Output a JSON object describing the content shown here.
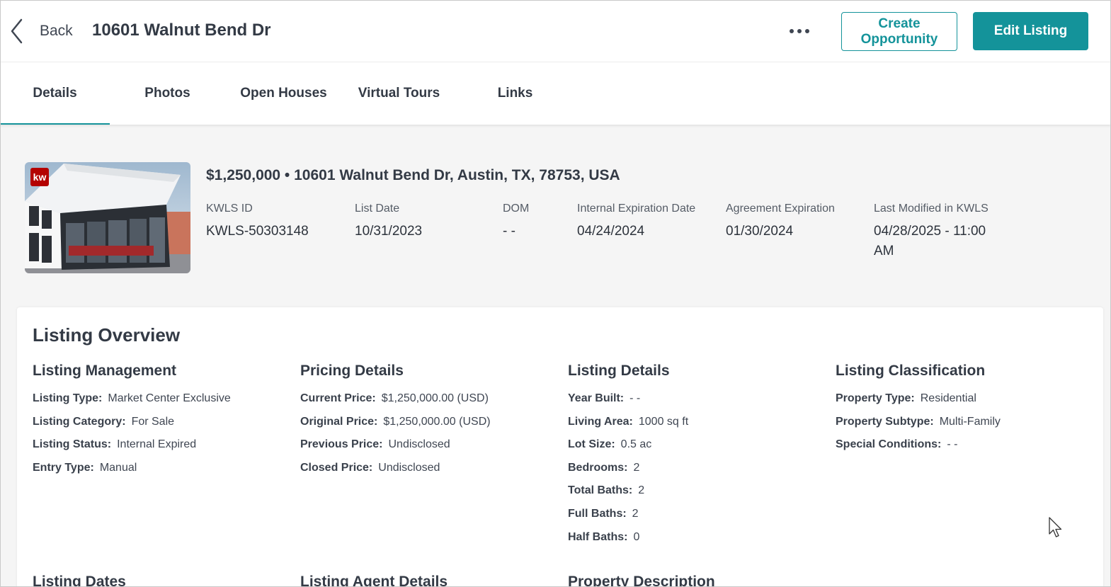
{
  "header": {
    "back_label": "Back",
    "title": "10601 Walnut Bend Dr",
    "more_icon": "more-horizontal-icon",
    "create_opportunity_label": "Create Opportunity",
    "edit_listing_label": "Edit Listing",
    "accent_color": "#14939a"
  },
  "tabs": [
    {
      "label": "Details",
      "active": true
    },
    {
      "label": "Photos",
      "active": false
    },
    {
      "label": "Open Houses",
      "active": false
    },
    {
      "label": "Virtual Tours",
      "active": false
    },
    {
      "label": "Links",
      "active": false
    }
  ],
  "summary": {
    "title": "$1,250,000 • 10601 Walnut Bend Dr, Austin, TX, 78753, USA",
    "badge": "kw",
    "meta": [
      {
        "label": "KWLS ID",
        "value": "KWLS-50303148"
      },
      {
        "label": "List Date",
        "value": "10/31/2023"
      },
      {
        "label": "DOM",
        "value": "- -"
      },
      {
        "label": "Internal Expiration Date",
        "value": "04/24/2024"
      },
      {
        "label": "Agreement Expiration",
        "value": "01/30/2024"
      },
      {
        "label": "Last Modified in KWLS",
        "value": "04/28/2025 - 11:00 AM"
      }
    ]
  },
  "overview": {
    "title": "Listing Overview",
    "sections": [
      {
        "title": "Listing Management",
        "rows": [
          {
            "label": "Listing Type:",
            "value": "Market Center Exclusive"
          },
          {
            "label": "Listing Category:",
            "value": "For Sale"
          },
          {
            "label": "Listing Status:",
            "value": "Internal Expired"
          },
          {
            "label": "Entry Type:",
            "value": "Manual"
          }
        ]
      },
      {
        "title": "Pricing Details",
        "rows": [
          {
            "label": "Current Price:",
            "value": "$1,250,000.00 (USD)"
          },
          {
            "label": "Original Price:",
            "value": "$1,250,000.00 (USD)"
          },
          {
            "label": "Previous Price:",
            "value": "Undisclosed"
          },
          {
            "label": "Closed Price:",
            "value": "Undisclosed"
          }
        ]
      },
      {
        "title": "Listing Details",
        "rows": [
          {
            "label": "Year Built:",
            "value": "- -"
          },
          {
            "label": "Living Area:",
            "value": "1000 sq ft"
          },
          {
            "label": "Lot Size:",
            "value": "0.5 ac"
          },
          {
            "label": "Bedrooms:",
            "value": "2"
          },
          {
            "label": "Total Baths:",
            "value": "2"
          },
          {
            "label": "Full Baths:",
            "value": "2"
          },
          {
            "label": "Half Baths:",
            "value": "0"
          }
        ]
      },
      {
        "title": "Listing Classification",
        "rows": [
          {
            "label": "Property Type:",
            "value": "Residential"
          },
          {
            "label": "Property Subtype:",
            "value": "Multi-Family"
          },
          {
            "label": "Special Conditions:",
            "value": "- -"
          }
        ]
      }
    ],
    "next_sections": [
      "Listing Dates",
      "Listing Agent Details",
      "Property Description"
    ]
  }
}
